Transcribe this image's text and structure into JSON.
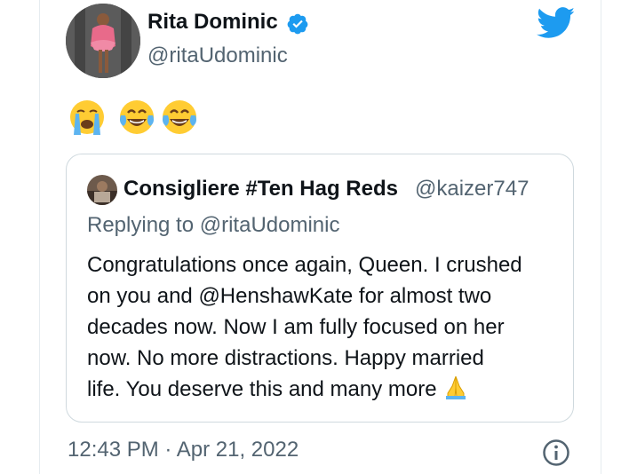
{
  "author": {
    "name": "Rita Dominic",
    "handle": "@ritaUdominic",
    "verified": true,
    "avatar_icon": "profile-photo"
  },
  "tweet": {
    "emojis": [
      "loudly-crying-face",
      "face-with-tears-of-joy",
      "face-with-tears-of-joy"
    ]
  },
  "quoted_tweet": {
    "author_name": "Consigliere #Ten Hag Reds",
    "author_handle": "@kaizer747",
    "replying_to": "Replying to @ritaUdominic",
    "lines": [
      "Congratulations once again, Queen. I crushed",
      "on you and @HenshawKate for almost two",
      "decades now. Now I am fully focused on her",
      "now. No more distractions. Happy married",
      "life. You deserve this and many more"
    ],
    "trailing_emoji": "folded-hands"
  },
  "footer": {
    "timestamp": "12:43 PM · Apr 21, 2022",
    "info_icon": "info-icon"
  },
  "colors": {
    "twitter_blue": "#1d9bf0",
    "secondary_text": "#536471",
    "border": "#cfd9de"
  }
}
